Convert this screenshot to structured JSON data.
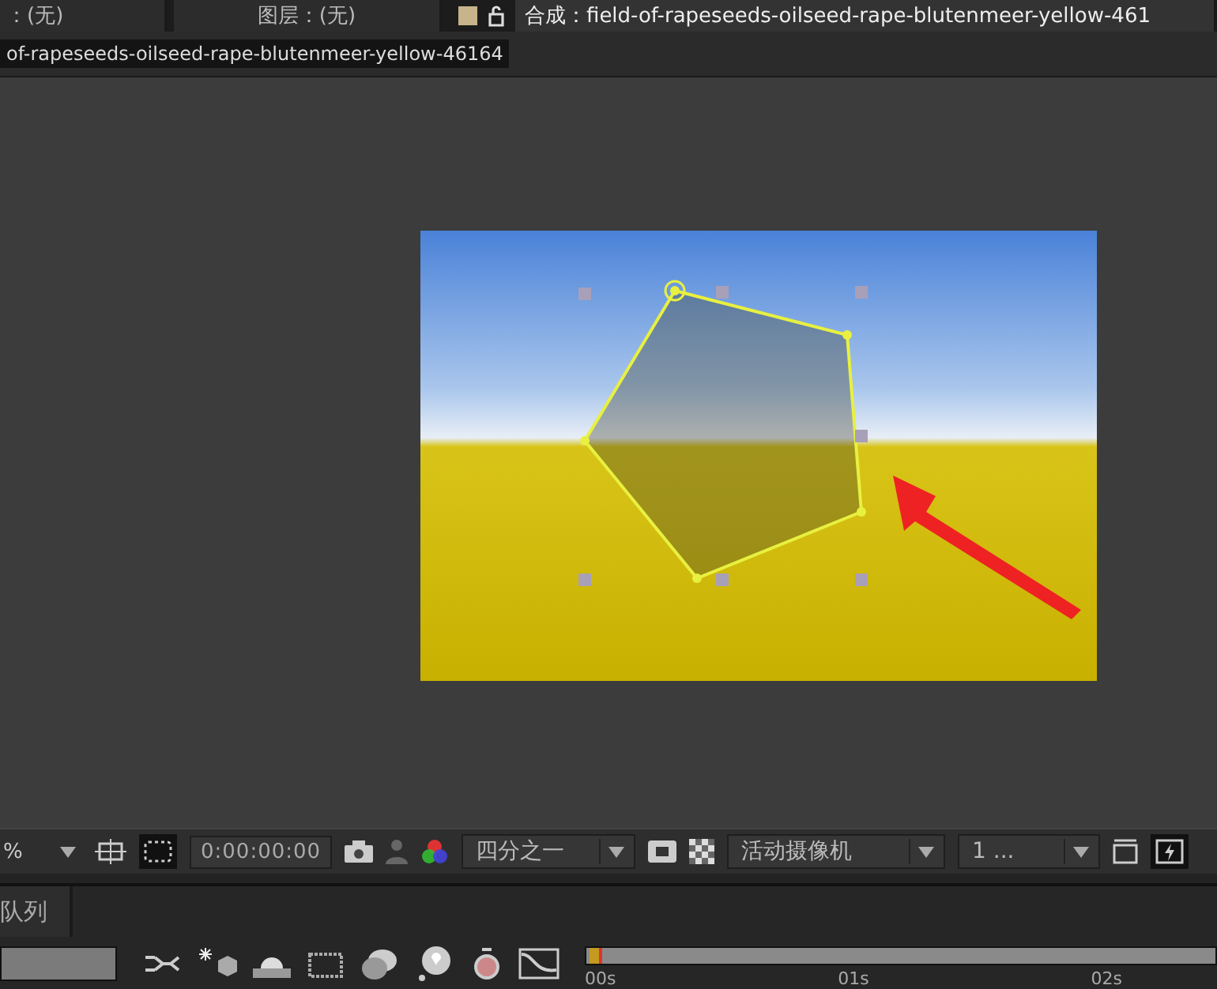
{
  "panel_tabs": [
    {
      "label": "：(无)",
      "selected": false
    },
    {
      "label": "图层：(无)",
      "selected": false
    },
    {
      "label": "合成：field-of-rapeseeds-oilseed-rape-blutenmeer-yellow-461",
      "selected": true
    }
  ],
  "composition_breadcrumb": "of-rapeseeds-oilseed-rape-blutenmeer-yellow-46164",
  "viewer_toolbar": {
    "zoom": "%",
    "timecode": "0:00:00:00",
    "resolution": "四分之一",
    "camera": "活动摄像机",
    "views": "1 ..."
  },
  "bottom_panel": {
    "tab": "队列",
    "time_ruler": [
      "00s",
      "01s",
      "02s"
    ]
  }
}
